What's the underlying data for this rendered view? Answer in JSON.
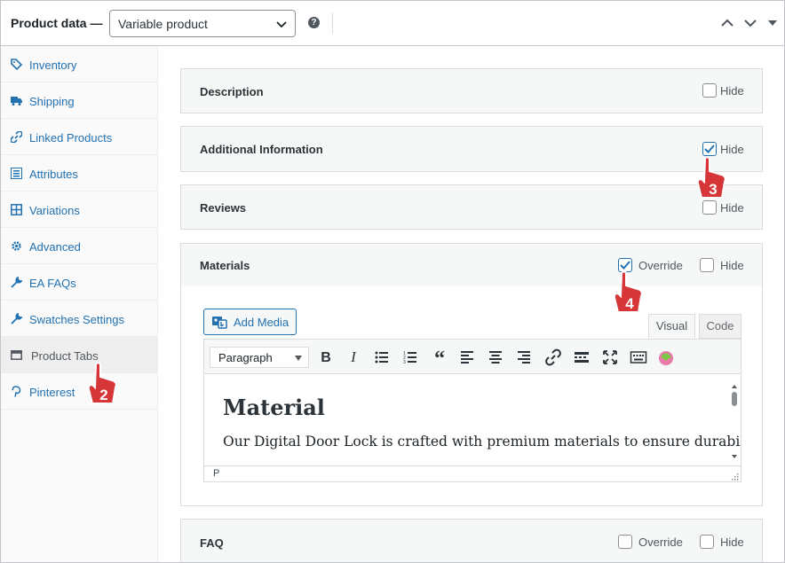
{
  "header": {
    "title": "Product data —",
    "product_type": "Variable product",
    "help": "?"
  },
  "sidebar": {
    "items": [
      {
        "label": "Inventory",
        "icon": "tag-icon"
      },
      {
        "label": "Shipping",
        "icon": "truck-icon"
      },
      {
        "label": "Linked Products",
        "icon": "link-icon"
      },
      {
        "label": "Attributes",
        "icon": "list-icon"
      },
      {
        "label": "Variations",
        "icon": "grid-icon"
      },
      {
        "label": "Advanced",
        "icon": "gear-icon"
      },
      {
        "label": "EA FAQs",
        "icon": "wrench-icon"
      },
      {
        "label": "Swatches Settings",
        "icon": "wrench-icon"
      },
      {
        "label": "Product Tabs",
        "icon": "tabs-icon",
        "active": true
      },
      {
        "label": "Pinterest",
        "icon": "pinterest-icon"
      }
    ]
  },
  "panels": {
    "description": {
      "title": "Description",
      "hide_label": "Hide",
      "hide_checked": false
    },
    "additional": {
      "title": "Additional Information",
      "hide_label": "Hide",
      "hide_checked": true
    },
    "reviews": {
      "title": "Reviews",
      "hide_label": "Hide",
      "hide_checked": false
    },
    "materials": {
      "title": "Materials",
      "override_label": "Override",
      "override_checked": true,
      "hide_label": "Hide",
      "hide_checked": false
    },
    "faq": {
      "title": "FAQ",
      "override_label": "Override",
      "override_checked": false,
      "hide_label": "Hide",
      "hide_checked": false
    }
  },
  "editor": {
    "add_media": "Add Media",
    "tab_visual": "Visual",
    "tab_code": "Code",
    "format": "Paragraph",
    "heading": "Material",
    "body": "Our Digital Door Lock is crafted with premium materials to ensure durability,",
    "path": "P"
  },
  "badges": {
    "two": "2",
    "three": "3",
    "four": "4"
  },
  "colors": {
    "accent": "#2271b1",
    "badge": "#d63638"
  }
}
